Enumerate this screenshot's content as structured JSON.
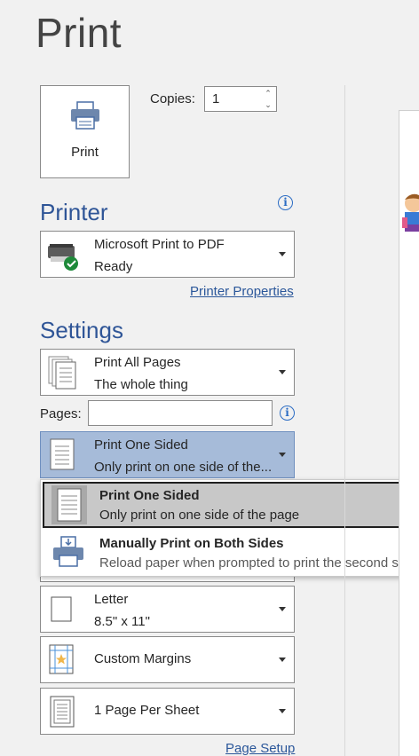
{
  "page": {
    "title": "Print"
  },
  "print_button": {
    "label": "Print",
    "icon": "printer-icon"
  },
  "copies": {
    "label": "Copies:",
    "value": "1"
  },
  "printer": {
    "heading": "Printer",
    "name": "Microsoft Print to PDF",
    "status": "Ready",
    "properties_link": "Printer Properties"
  },
  "settings": {
    "heading": "Settings",
    "print_range": {
      "title": "Print All Pages",
      "subtitle": "The whole thing"
    },
    "pages_label": "Pages:",
    "pages_value": "",
    "sides": {
      "title": "Print One Sided",
      "subtitle": "Only print on one side of the..."
    },
    "sides_menu": [
      {
        "title": "Print One Sided",
        "subtitle": "Only print on one side of the page"
      },
      {
        "title": "Manually Print on Both Sides",
        "subtitle": "Reload paper when prompted to print the second side"
      }
    ],
    "paper": {
      "title": "Letter",
      "subtitle": "8.5\" x 11\""
    },
    "margins": {
      "title": "Custom Margins"
    },
    "per_sheet": {
      "title": "1 Page Per Sheet"
    },
    "page_setup_link": "Page Setup"
  },
  "colors": {
    "accent": "#2f5597",
    "selected": "#a6bbd9",
    "link": "#2b579a"
  }
}
